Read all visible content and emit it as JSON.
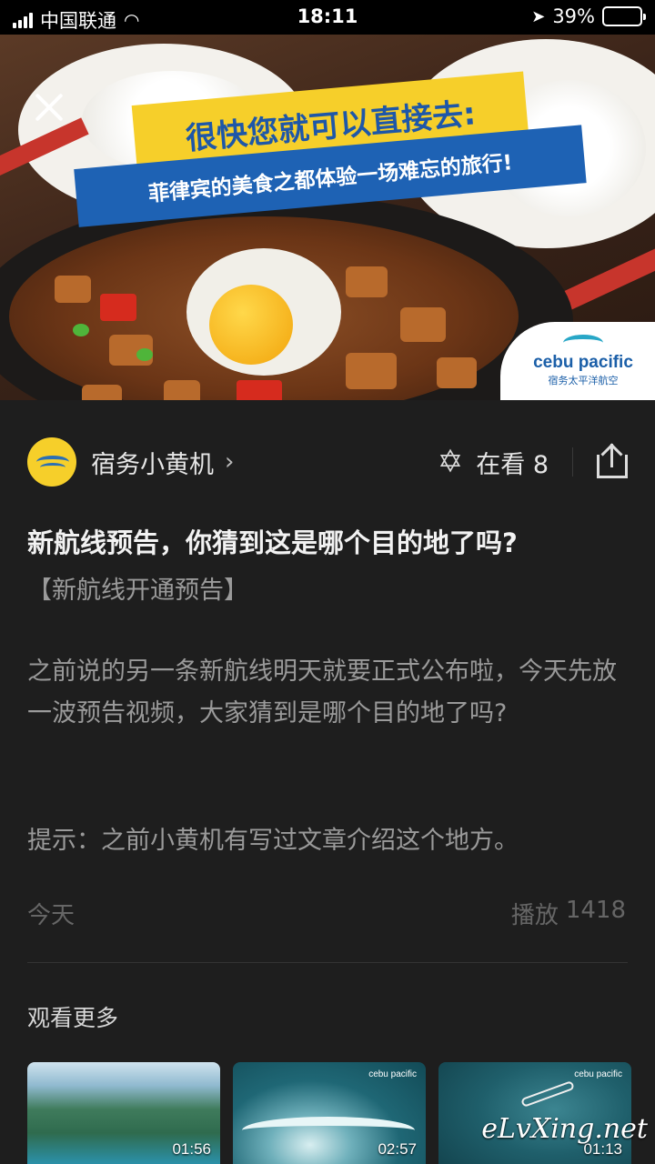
{
  "status_bar": {
    "carrier": "中国联通",
    "time": "18:11",
    "battery_percent": "39%",
    "battery_level": 0.39,
    "battery_color": "#f5c518"
  },
  "hero": {
    "banner_line1": "很快您就可以直接去:",
    "banner_line2": "菲律宾的美食之都体验一场难忘的旅行!",
    "logo_text": "cebu pacific",
    "logo_sub": "宿务太平洋航空",
    "close_icon": "close-icon"
  },
  "account": {
    "name": "宿务小黄机",
    "chevron": "›",
    "watching_label": "在看",
    "watching_count": "8",
    "icons": [
      "star-icon",
      "share-icon"
    ]
  },
  "article": {
    "title": "新航线预告，你猜到这是哪个目的地了吗?",
    "subtitle": "【新航线开通预告】",
    "body1": "之前说的另一条新航线明天就要正式公布啦，今天先放一波预告视频，大家猜到是哪个目的地了吗?",
    "body2": "提示：之前小黄机有写过文章介绍这个地方。",
    "date": "今天",
    "plays_label": "播放",
    "plays_count": "1418"
  },
  "more": {
    "title": "观看更多",
    "videos": [
      {
        "duration": "01:56",
        "brand": ""
      },
      {
        "duration": "02:57",
        "brand": "cebu pacific"
      },
      {
        "duration": "01:13",
        "brand": "cebu pacific"
      }
    ]
  },
  "watermark": "eLvXing.net",
  "colors": {
    "background": "#1e1e1e",
    "brand_yellow": "#f6cf2a",
    "brand_blue": "#1e62b4"
  }
}
